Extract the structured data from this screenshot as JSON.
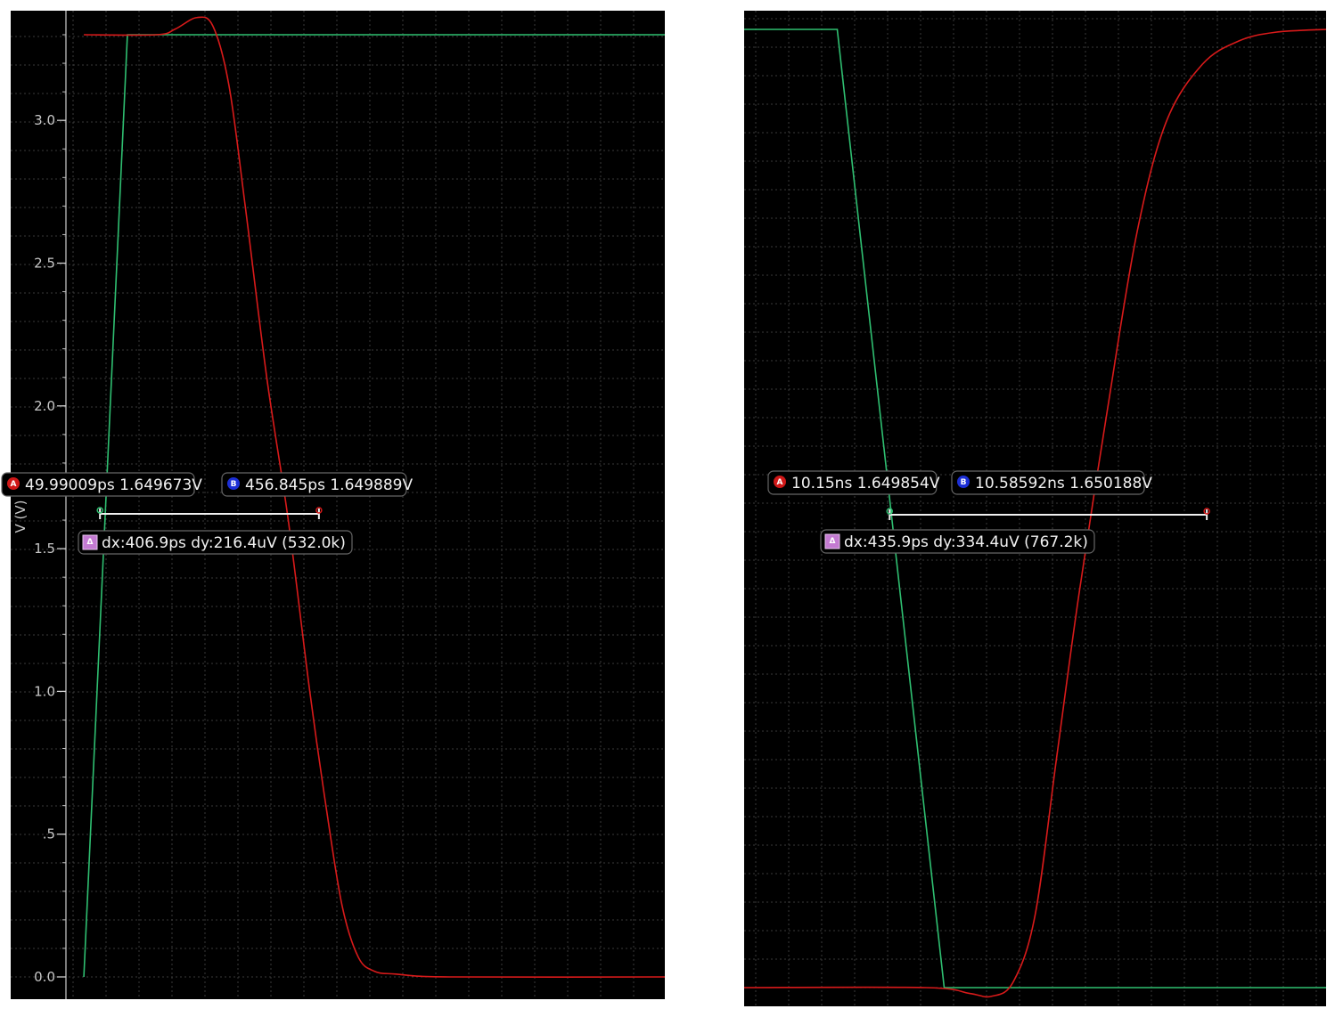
{
  "chart_data": [
    {
      "type": "line",
      "title": "",
      "xlabel": "",
      "ylabel": "V (V)",
      "ylim": [
        -0.08,
        3.3
      ],
      "xlim": [
        0,
        1100
      ],
      "x_unit": "ps",
      "yticks": [
        {
          "value": 3.0,
          "label": "3.0"
        },
        {
          "value": 2.5,
          "label": "2.5"
        },
        {
          "value": 2.0,
          "label": "2.0"
        },
        {
          "value": 1.5,
          "label": "1.5"
        },
        {
          "value": 1.0,
          "label": "1.0"
        },
        {
          "value": 0.5,
          "label": ".5"
        },
        {
          "value": 0.0,
          "label": "0.0"
        }
      ],
      "grid": true,
      "series": [
        {
          "color": "#2fbf71",
          "points": [
            [
              20,
              0
            ],
            [
              101,
              3.3
            ],
            [
              1100,
              3.3
            ]
          ]
        },
        {
          "color": "#d81a1a",
          "points": [
            [
              20,
              3.3
            ],
            [
              155,
              3.3
            ],
            [
              190,
              3.32
            ],
            [
              230,
              3.36
            ],
            [
              260,
              3.33
            ],
            [
              290,
              3.12
            ],
            [
              320,
              2.7
            ],
            [
              360,
              2.1
            ],
            [
              400,
              1.6
            ],
            [
              440,
              1.0
            ],
            [
              470,
              0.6
            ],
            [
              500,
              0.25
            ],
            [
              530,
              0.07
            ],
            [
              560,
              0.02
            ],
            [
              600,
              0.01
            ],
            [
              700,
              0
            ],
            [
              1100,
              0
            ]
          ]
        }
      ],
      "markers": {
        "a": {
          "badge": "A",
          "x": 50,
          "y": 1.65,
          "label": "49.99009ps 1.649673V"
        },
        "b": {
          "badge": "B",
          "x": 457,
          "y": 1.65,
          "label": "456.845ps 1.649889V"
        },
        "delta": {
          "badge": "Δ",
          "label": "dx:406.9ps dy:216.4uV (532.0k)"
        }
      },
      "colors": {
        "background": "#000000",
        "green_trace": "#2fbf71",
        "red_trace": "#d81a1a",
        "marker_a": "#d01818",
        "marker_b": "#1c2fd6",
        "delta_badge": "#c47ad2"
      }
    },
    {
      "type": "line",
      "title": "",
      "xlabel": "",
      "ylabel": "",
      "ylim": [
        -0.03,
        3.3
      ],
      "xlim": [
        9.95,
        10.75
      ],
      "x_unit": "ns",
      "grid": true,
      "series": [
        {
          "color": "#2fbf71",
          "points": [
            [
              9.95,
              3.3
            ],
            [
              10.078,
              3.3
            ],
            [
              10.225,
              0
            ],
            [
              10.75,
              0
            ]
          ]
        },
        {
          "color": "#d81a1a",
          "points": [
            [
              9.95,
              0
            ],
            [
              10.2,
              0
            ],
            [
              10.26,
              -0.02
            ],
            [
              10.29,
              -0.03
            ],
            [
              10.32,
              0.02
            ],
            [
              10.35,
              0.25
            ],
            [
              10.38,
              0.8
            ],
            [
              10.41,
              1.35
            ],
            [
              10.45,
              2.0
            ],
            [
              10.49,
              2.6
            ],
            [
              10.53,
              2.98
            ],
            [
              10.58,
              3.18
            ],
            [
              10.63,
              3.26
            ],
            [
              10.68,
              3.29
            ],
            [
              10.75,
              3.3
            ]
          ]
        }
      ],
      "markers": {
        "a": {
          "badge": "A",
          "x": 10.15,
          "y": 1.65,
          "label": "10.15ns 1.649854V"
        },
        "b": {
          "badge": "B",
          "x": 10.586,
          "y": 1.65,
          "label": "10.58592ns 1.650188V"
        },
        "delta": {
          "badge": "Δ",
          "label": "dx:435.9ps dy:334.4uV (767.2k)"
        }
      },
      "colors": {
        "background": "#000000",
        "green_trace": "#2fbf71",
        "red_trace": "#d81a1a",
        "marker_a": "#d01818",
        "marker_b": "#1c2fd6",
        "delta_badge": "#c47ad2"
      }
    }
  ]
}
